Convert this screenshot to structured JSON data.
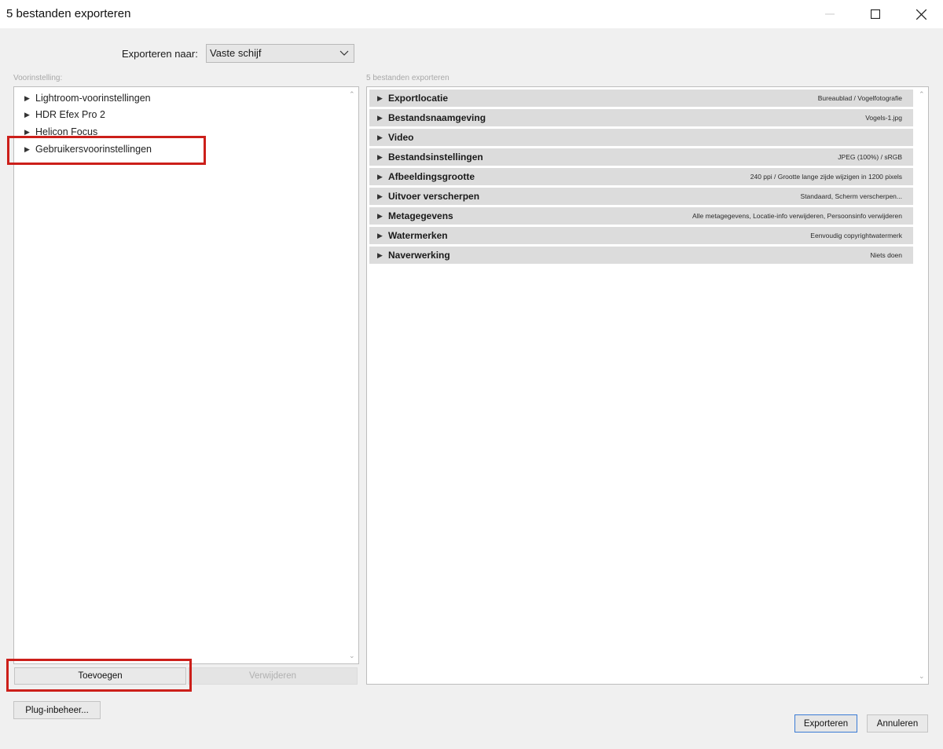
{
  "window": {
    "title": "5 bestanden exporteren"
  },
  "destination": {
    "label": "Exporteren naar:",
    "value": "Vaste schijf"
  },
  "presets": {
    "label": "Voorinstelling:",
    "items": [
      {
        "label": "Lightroom-voorinstellingen"
      },
      {
        "label": "HDR Efex Pro 2"
      },
      {
        "label": "Helicon Focus"
      },
      {
        "label": "Gebruikersvoorinstellingen"
      }
    ],
    "add_label": "Toevoegen",
    "remove_label": "Verwijderen"
  },
  "export_settings": {
    "label": "5 bestanden exporteren",
    "sections": [
      {
        "name": "Exportlocatie",
        "summary": "Bureaublad / Vogelfotografie"
      },
      {
        "name": "Bestandsnaamgeving",
        "summary": "Vogels-1.jpg"
      },
      {
        "name": "Video",
        "summary": ""
      },
      {
        "name": "Bestandsinstellingen",
        "summary": "JPEG (100%) / sRGB"
      },
      {
        "name": "Afbeeldingsgrootte",
        "summary": "240 ppi / Grootte lange zijde wijzigen in 1200 pixels"
      },
      {
        "name": "Uitvoer verscherpen",
        "summary": "Standaard, Scherm verscherpen..."
      },
      {
        "name": "Metagegevens",
        "summary": "Alle metagegevens, Locatie-info verwijderen, Persoonsinfo verwijderen"
      },
      {
        "name": "Watermerken",
        "summary": "Eenvoudig copyrightwatermerk"
      },
      {
        "name": "Naverwerking",
        "summary": "Niets doen"
      }
    ]
  },
  "footer": {
    "plugin_label": "Plug-inbeheer...",
    "export_label": "Exporteren",
    "cancel_label": "Annuleren"
  },
  "colors": {
    "highlight": "#cc1f1a",
    "primary_border": "#3a7bd5"
  }
}
